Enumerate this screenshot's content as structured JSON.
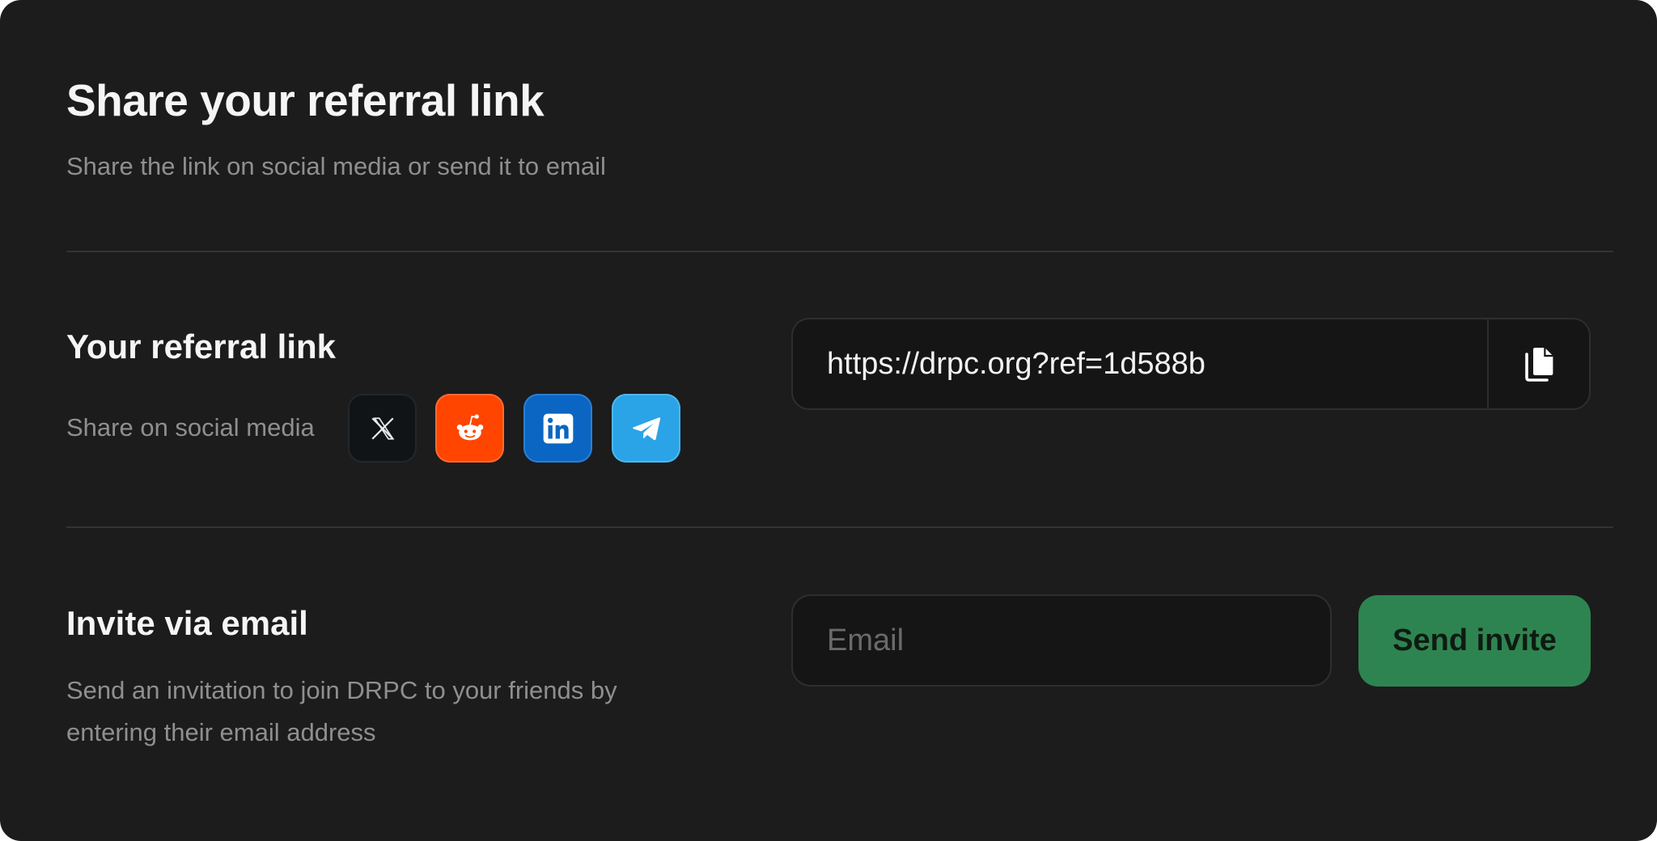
{
  "header": {
    "title": "Share your referral link",
    "subtitle": "Share the link on social media or send it to email"
  },
  "referral": {
    "title": "Your referral link",
    "share_label": "Share on social media",
    "link": "https://drpc.org?ref=1d588b",
    "copy_icon": "copy-icon",
    "socials": [
      {
        "name": "x",
        "icon": "x-logo-icon",
        "color": "#111416"
      },
      {
        "name": "reddit",
        "icon": "reddit-logo-icon",
        "color": "#ff4500"
      },
      {
        "name": "linkedin",
        "icon": "linkedin-logo-icon",
        "color": "#0a66c2"
      },
      {
        "name": "telegram",
        "icon": "telegram-logo-icon",
        "color": "#2aa4e6"
      }
    ]
  },
  "invite": {
    "title": "Invite via email",
    "description": "Send an invitation to join DRPC to your friends by entering their email address",
    "email_placeholder": "Email",
    "email_value": "",
    "send_label": "Send invite"
  },
  "colors": {
    "background": "#1c1c1c",
    "accent_green": "#2e8450",
    "text_primary": "#f5f5f5",
    "text_muted": "#8f8f8f"
  }
}
